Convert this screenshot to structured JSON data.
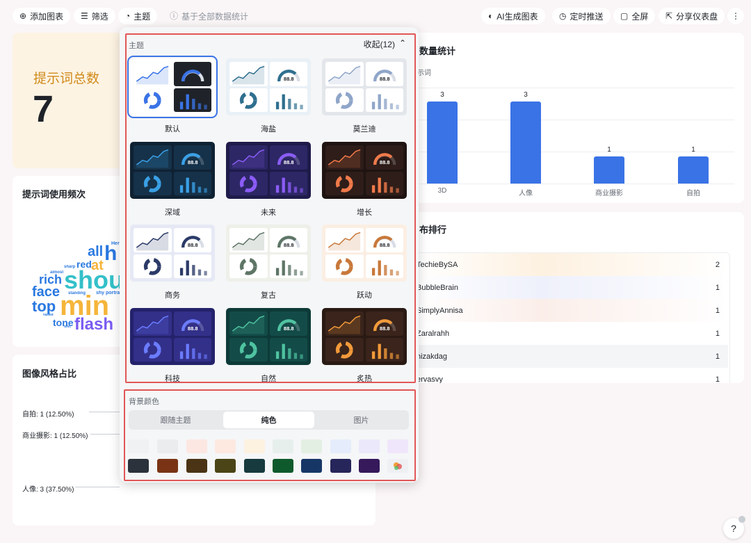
{
  "toolbar": {
    "add_chart": "添加图表",
    "filter": "筛选",
    "theme": "主题",
    "stat_scope": "基于全部数据统计",
    "ai_chart": "AI生成图表",
    "schedule": "定时推送",
    "fullscreen": "全屏",
    "share": "分享仪表盘"
  },
  "kpi": {
    "title": "提示词总数",
    "value": "7"
  },
  "wordcloud": {
    "title": "提示词使用频次",
    "words": [
      {
        "text": "all",
        "color": "#2a79e0"
      },
      {
        "text": "h",
        "color": "#2a79e0"
      },
      {
        "text": "Her",
        "color": "#2a79e0"
      },
      {
        "text": "red",
        "color": "#2a79e0"
      },
      {
        "text": "at",
        "color": "#f5b53a"
      },
      {
        "text": "sharp",
        "color": "#2a79e0"
      },
      {
        "text": "almost",
        "color": "#2a79e0"
      },
      {
        "text": "shou",
        "color": "#34c0c9"
      },
      {
        "text": "rich",
        "color": "#2a79e0"
      },
      {
        "text": "face",
        "color": "#2a79e0"
      },
      {
        "text": "standing",
        "color": "#2a79e0"
      },
      {
        "text": "shy portrait",
        "color": "#2a79e0"
      },
      {
        "text": "top",
        "color": "#2a79e0"
      },
      {
        "text": "min",
        "color": "#f5b53a"
      },
      {
        "text": "raised",
        "color": "#2a79e0"
      },
      {
        "text": "tone",
        "color": "#2a79e0"
      },
      {
        "text": "disc",
        "color": "#2a79e0"
      },
      {
        "text": "flash",
        "color": "#7a5cf0"
      }
    ]
  },
  "pie": {
    "title": "图像风格占比",
    "labels": [
      "自拍: 1 (12.50%)",
      "商业摄影: 1 (12.50%)",
      "人像: 3 (37.50%)"
    ]
  },
  "bar_card": {
    "title": "数量统计",
    "subtitle": "示词"
  },
  "chart_data": {
    "type": "bar",
    "categories": [
      "3D",
      "人像",
      "商业摄影",
      "自拍"
    ],
    "values": [
      3,
      3,
      1,
      1
    ],
    "ylim": [
      0,
      3.5
    ],
    "color": "#3a73e6"
  },
  "ranking": {
    "title": "布排行",
    "rows": [
      {
        "name": "TechieBySA",
        "value": "2"
      },
      {
        "name": "BubbleBrain",
        "value": "1"
      },
      {
        "name": "SimplyAnnisa",
        "value": "1"
      },
      {
        "name": "Zaralrahh",
        "value": "1"
      },
      {
        "name": "hizakdag",
        "value": "1"
      },
      {
        "name": "ervasvy",
        "value": "1"
      }
    ]
  },
  "popup": {
    "theme_label": "主题",
    "collapse": "收起(12)",
    "gauge_value": "88.8",
    "themes": [
      {
        "name": "默认",
        "bg": "#ffffff",
        "cell": "#f3f6fb",
        "accent": "#3a73e6",
        "dark": false
      },
      {
        "name": "海盐",
        "bg": "#e9f1f7",
        "cell": "#ffffff",
        "accent": "#2f6f8f",
        "dark": false
      },
      {
        "name": "莫兰迪",
        "bg": "#e3e6ea",
        "cell": "#ffffff",
        "accent": "#8fa6c9",
        "dark": false
      },
      {
        "name": "深域",
        "bg": "#0f2233",
        "cell": "#16324a",
        "accent": "#3aa0e6",
        "dark": true
      },
      {
        "name": "未来",
        "bg": "#1f1b4a",
        "cell": "#2d2766",
        "accent": "#8b5cf6",
        "dark": true
      },
      {
        "name": "增长",
        "bg": "#1f1412",
        "cell": "#2e1d19",
        "accent": "#f07a4a",
        "dark": true
      },
      {
        "name": "商务",
        "bg": "#e6e9f5",
        "cell": "#ffffff",
        "accent": "#2b3a67",
        "dark": false
      },
      {
        "name": "复古",
        "bg": "#eef0ea",
        "cell": "#ffffff",
        "accent": "#5e7566",
        "dark": false
      },
      {
        "name": "跃动",
        "bg": "#fbeee3",
        "cell": "#ffffff",
        "accent": "#c8783a",
        "dark": false
      },
      {
        "name": "科技",
        "bg": "#24226b",
        "cell": "#33308a",
        "accent": "#6b7cff",
        "dark": true
      },
      {
        "name": "自然",
        "bg": "#0d3a38",
        "cell": "#134b48",
        "accent": "#4fc3a1",
        "dark": true
      },
      {
        "name": "炙热",
        "bg": "#2a1a14",
        "cell": "#3a241b",
        "accent": "#f29a3a",
        "dark": true
      }
    ],
    "bg_label": "背景颜色",
    "tabs": [
      "跟随主题",
      "纯色",
      "图片"
    ],
    "light_colors": [
      "#f0f1f3",
      "#ebecee",
      "#fde7e2",
      "#fde9e0",
      "#fdf1e0",
      "#e6efec",
      "#e3efe3",
      "#e5ecfb",
      "#ebe8fb",
      "#f0e6fb"
    ],
    "dark_colors": [
      "#2b323b",
      "#7a3415",
      "#4a3415",
      "#4b4416",
      "#163a3d",
      "#0f5a2c",
      "#163766",
      "#26265a",
      "#35195a"
    ]
  },
  "help": "?"
}
